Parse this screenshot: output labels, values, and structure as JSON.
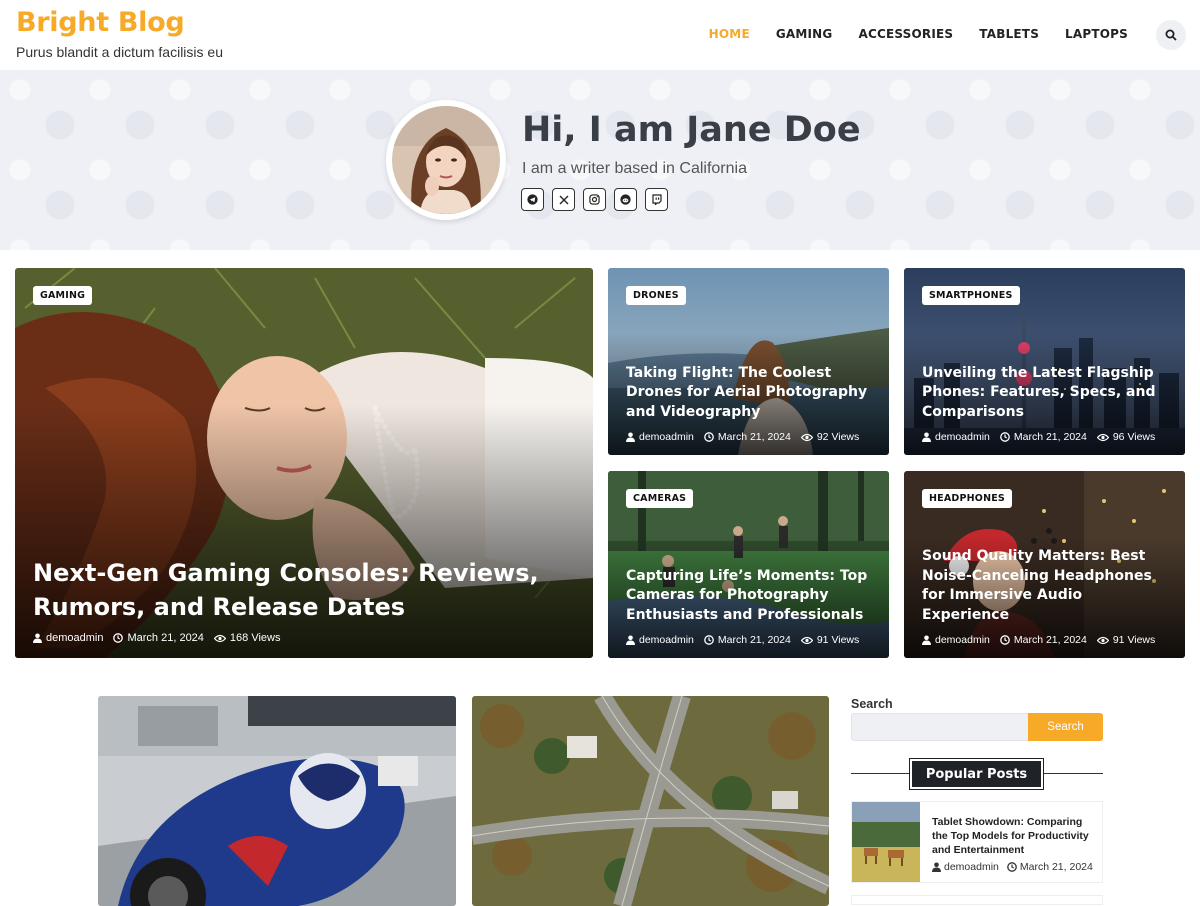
{
  "site": {
    "title": "Bright Blog",
    "tagline": "Purus blandit a dictum facilisis eu"
  },
  "nav": {
    "items": [
      {
        "label": "HOME",
        "active": true
      },
      {
        "label": "GAMING",
        "active": false
      },
      {
        "label": "ACCESSORIES",
        "active": false
      },
      {
        "label": "TABLETS",
        "active": false
      },
      {
        "label": "LAPTOPS",
        "active": false
      }
    ],
    "search_icon": "search-icon"
  },
  "hero": {
    "name": "Hi, I am Jane Doe",
    "subtitle": "I am a writer based in California",
    "social": [
      "telegram-icon",
      "x-icon",
      "instagram-icon",
      "reddit-icon",
      "twitch-icon"
    ]
  },
  "featured": {
    "main": {
      "category": "GAMING",
      "title": "Next-Gen Gaming Consoles: Reviews, Rumors, and Release Dates",
      "author": "demoadmin",
      "date": "March 21, 2024",
      "views": "168 Views"
    },
    "posts": [
      {
        "category": "DRONES",
        "title": "Taking Flight: The Coolest Drones for Aerial Photography and Videography",
        "author": "demoadmin",
        "date": "March 21, 2024",
        "views": "92 Views"
      },
      {
        "category": "SMARTPHONES",
        "title": "Unveiling the Latest Flagship Phones: Features, Specs, and Comparisons",
        "author": "demoadmin",
        "date": "March 21, 2024",
        "views": "96 Views"
      },
      {
        "category": "CAMERAS",
        "title": "Capturing Life’s Moments: Top Cameras for Photography Enthusiasts and Professionals",
        "author": "demoadmin",
        "date": "March 21, 2024",
        "views": "91 Views"
      },
      {
        "category": "HEADPHONES",
        "title": "Sound Quality Matters: Best Noise-Canceling Headphones for Immersive Audio Experience",
        "author": "demoadmin",
        "date": "March 21, 2024",
        "views": "91 Views"
      }
    ]
  },
  "sidebar": {
    "search_label": "Search",
    "search_placeholder": "",
    "search_button": "Search",
    "popular_heading": "Popular Posts",
    "popular": [
      {
        "title": "Tablet Showdown: Comparing the Top Models for Productivity and Entertainment",
        "author": "demoadmin",
        "date": "March 21, 2024"
      }
    ]
  },
  "colors": {
    "accent": "#f7a928",
    "dark": "#1f2227",
    "hero_bg": "#eef0f5"
  }
}
